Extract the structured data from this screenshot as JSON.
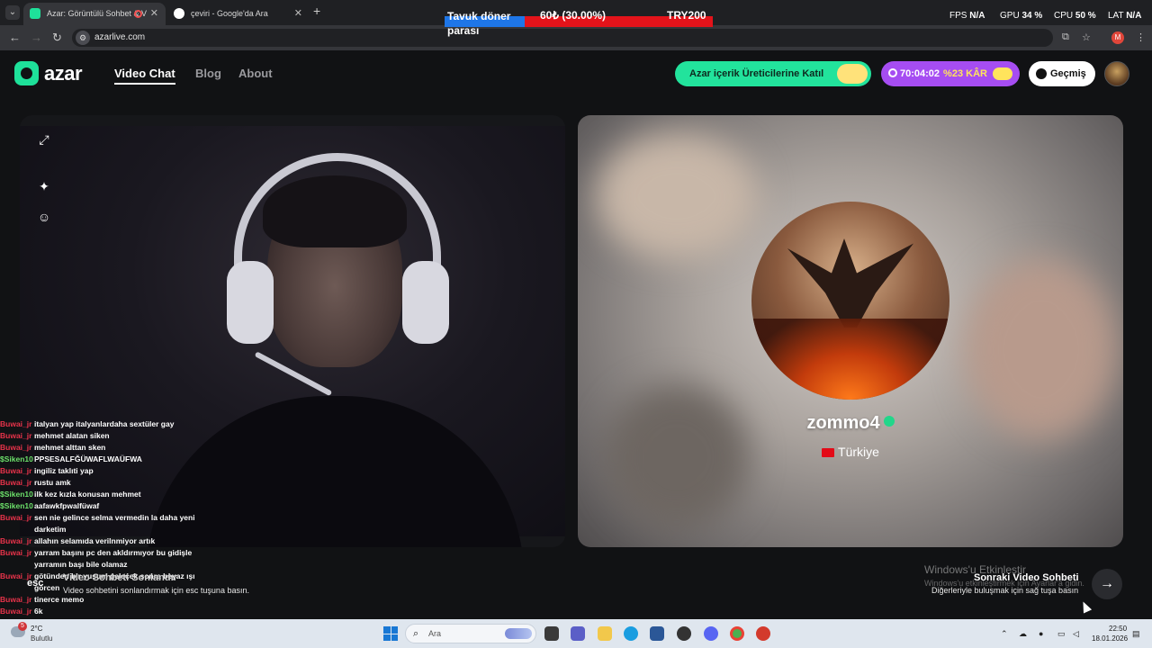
{
  "browser": {
    "tabs": [
      {
        "title": "Azar: Görüntülü Sohbet & V",
        "active": true
      },
      {
        "title": "çeviri - Google'da Ara",
        "active": false
      }
    ],
    "url": "azarlive.com",
    "profile_initial": "M"
  },
  "overlay": {
    "donation": {
      "title": "Tavuk döner parası",
      "amount": "60₺ (30.00%)",
      "progress_percent": 30,
      "goal": "TRY200"
    },
    "stats": [
      {
        "label": "FPS",
        "value": "N/A"
      },
      {
        "label": "GPU",
        "value": "34 %"
      },
      {
        "label": "CPU",
        "value": "50 %"
      },
      {
        "label": "LAT",
        "value": "N/A"
      }
    ]
  },
  "site": {
    "logo_text": "azar",
    "nav": [
      {
        "label": "Video Chat",
        "active": true
      },
      {
        "label": "Blog",
        "active": false
      },
      {
        "label": "About",
        "active": false
      }
    ],
    "creator_button": "Azar içerik Üreticilerine Katıl",
    "timer": {
      "time": "70:04:02",
      "profit": "%23 KÂR"
    },
    "history_button": "Geçmiş"
  },
  "partner": {
    "name": "zommo4",
    "country": "Türkiye"
  },
  "chat": [
    {
      "user": "Buwai_jr",
      "color": "red",
      "message": "italyan yap italyanlardaha sextüler gay"
    },
    {
      "user": "Buwai_jr",
      "color": "red",
      "message": "mehmet alatan siken"
    },
    {
      "user": "Buwai_jr",
      "color": "red",
      "message": "mehmet alttan sken"
    },
    {
      "user": "$Siken10",
      "color": "green",
      "message": "PPSESALFĞÜWAFLWAÜFWA"
    },
    {
      "user": "Buwai_jr",
      "color": "red",
      "message": "ingiliz taklıti yap"
    },
    {
      "user": "Buwai_jr",
      "color": "red",
      "message": "rustu amk"
    },
    {
      "user": "$Siken10",
      "color": "green",
      "message": "ilk kez kızla konusan mehmet"
    },
    {
      "user": "$Siken10",
      "color": "green",
      "message": "aafawkfpwalfüwaf"
    },
    {
      "user": "Buwai_jr",
      "color": "red",
      "message": "sen nie gelince selma vermedin la daha yeni darketim"
    },
    {
      "user": "Buwai_jr",
      "color": "red",
      "message": "allahın selamıda verilnmiyor artık"
    },
    {
      "user": "Buwai_jr",
      "color": "red",
      "message": "yarram başını pc den akldırmıyor bu gidişle yarramın başı bile olamaz"
    },
    {
      "user": "Buwai_jr",
      "color": "red",
      "message": "götünden bir yusum gelecek sonra beyaz ışı görcen"
    },
    {
      "user": "Buwai_jr",
      "color": "red",
      "message": "tinerce memo"
    },
    {
      "user": "Buwai_jr",
      "color": "red",
      "message": "6k"
    }
  ],
  "bottom": {
    "esc_key": "esc",
    "end_title": "Video Sohbeti Sonlandır",
    "end_sub": "Video sohbetini sonlandırmak için esc tuşuna basın.",
    "next_title": "Sonraki Video Sohbeti",
    "next_sub": "Diğerleriyle buluşmak için sağ tuşa basın",
    "windows_activation": "Windows'u Etkinleştir",
    "windows_activation_sub": "Windows'u etkinleştirmek için Ayarlar'a gidin."
  },
  "taskbar": {
    "weather_badge": "5",
    "temperature": "2°C",
    "weather": "Bulutlu",
    "search_placeholder": "Ara",
    "time": "22:50",
    "date": "18.01.2026"
  },
  "colors": {
    "azar_green": "#22e39c",
    "timer_purple": "#a64df2",
    "donation_blue": "#1e76e8",
    "donation_red": "#e3131a"
  }
}
